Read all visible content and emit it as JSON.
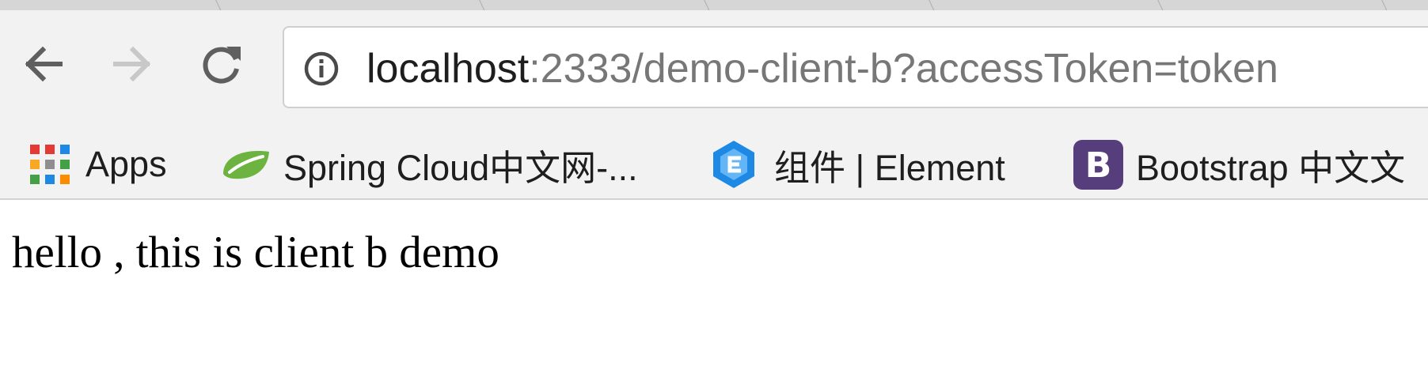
{
  "toolbar": {
    "back_icon": "back-arrow-icon",
    "forward_icon": "forward-arrow-icon",
    "reload_icon": "reload-icon",
    "site_info_icon": "info-icon"
  },
  "address_bar": {
    "host": "localhost",
    "rest": ":2333/demo-client-b?accessToken=token"
  },
  "bookmarks": [
    {
      "icon": "apps-grid-icon",
      "label": "Apps"
    },
    {
      "icon": "spring-leaf-icon",
      "label": "Spring Cloud中文网-..."
    },
    {
      "icon": "element-logo-icon",
      "label": "组件 | Element"
    },
    {
      "icon": "bootstrap-logo-icon",
      "label": "Bootstrap 中文文"
    }
  ],
  "page": {
    "body_text": "hello , this is client b demo"
  },
  "colors": {
    "chrome_bg": "#f2f2f2",
    "tabstrip_bg": "#d6d6d6",
    "url_host": "#1e1e1e",
    "url_path": "#777777",
    "bootstrap_purple": "#563d7c",
    "element_blue": "#1e88e5",
    "spring_green": "#6db33f"
  }
}
